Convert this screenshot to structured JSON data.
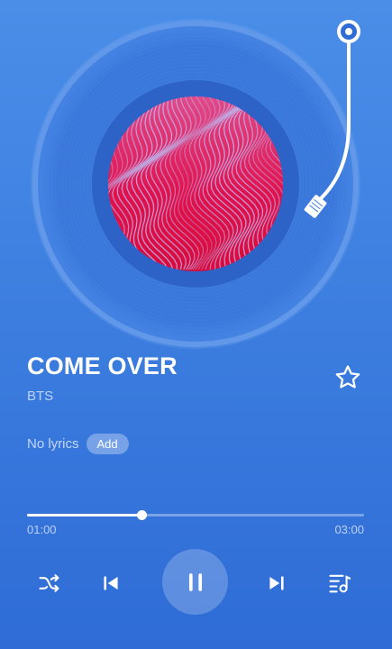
{
  "track": {
    "title": "COME OVER",
    "artist": "BTS",
    "favorite": false
  },
  "lyrics": {
    "status_text": "No lyrics",
    "add_label": "Add"
  },
  "playback": {
    "current_time": "01:00",
    "total_time": "03:00",
    "progress_fraction": 0.34,
    "state": "playing"
  },
  "controls": {
    "shuffle_icon": "shuffle-icon",
    "previous_icon": "skip-previous-icon",
    "play_pause_icon": "pause-icon",
    "next_icon": "skip-next-icon",
    "queue_icon": "playlist-icon"
  },
  "colors": {
    "background": "#3d7fe0",
    "album_art_primary": "#e0124e",
    "album_art_wave": "#b9c6ff"
  }
}
